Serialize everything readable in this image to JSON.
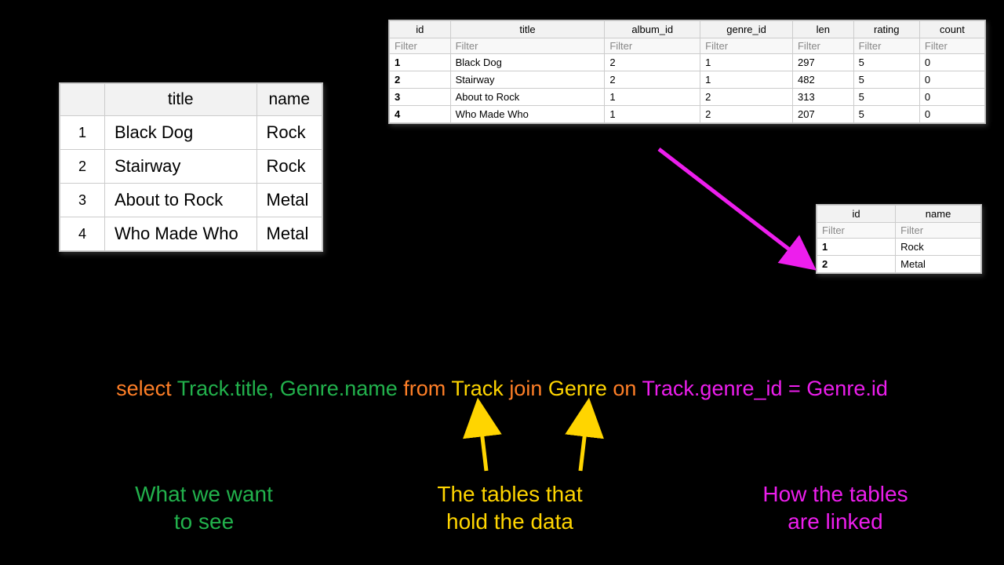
{
  "result_table": {
    "headers": [
      "",
      "title",
      "name"
    ],
    "rows": [
      [
        "1",
        "Black Dog",
        "Rock"
      ],
      [
        "2",
        "Stairway",
        "Rock"
      ],
      [
        "3",
        "About to Rock",
        "Metal"
      ],
      [
        "4",
        "Who Made Who",
        "Metal"
      ]
    ]
  },
  "track_table": {
    "headers": [
      "id",
      "title",
      "album_id",
      "genre_id",
      "len",
      "rating",
      "count"
    ],
    "filter": "Filter",
    "rows": [
      [
        "1",
        "Black Dog",
        "2",
        "1",
        "297",
        "5",
        "0"
      ],
      [
        "2",
        "Stairway",
        "2",
        "1",
        "482",
        "5",
        "0"
      ],
      [
        "3",
        "About to Rock",
        "1",
        "2",
        "313",
        "5",
        "0"
      ],
      [
        "4",
        "Who Made Who",
        "1",
        "2",
        "207",
        "5",
        "0"
      ]
    ]
  },
  "genre_table": {
    "headers": [
      "id",
      "name"
    ],
    "filter": "Filter",
    "rows": [
      [
        "1",
        "Rock"
      ],
      [
        "2",
        "Metal"
      ]
    ]
  },
  "sql": {
    "p1": "select ",
    "p2": "Track.title, Genre.name ",
    "p3": "from ",
    "p4": "Track ",
    "p5": "join ",
    "p6": "Genre ",
    "p7": "on ",
    "p8": "Track.genre_id = Genre.id"
  },
  "labels": {
    "l1a": "What we want",
    "l1b": "to see",
    "l2a": "The tables that",
    "l2b": "hold the data",
    "l3a": "How the tables",
    "l3b": "are linked"
  }
}
